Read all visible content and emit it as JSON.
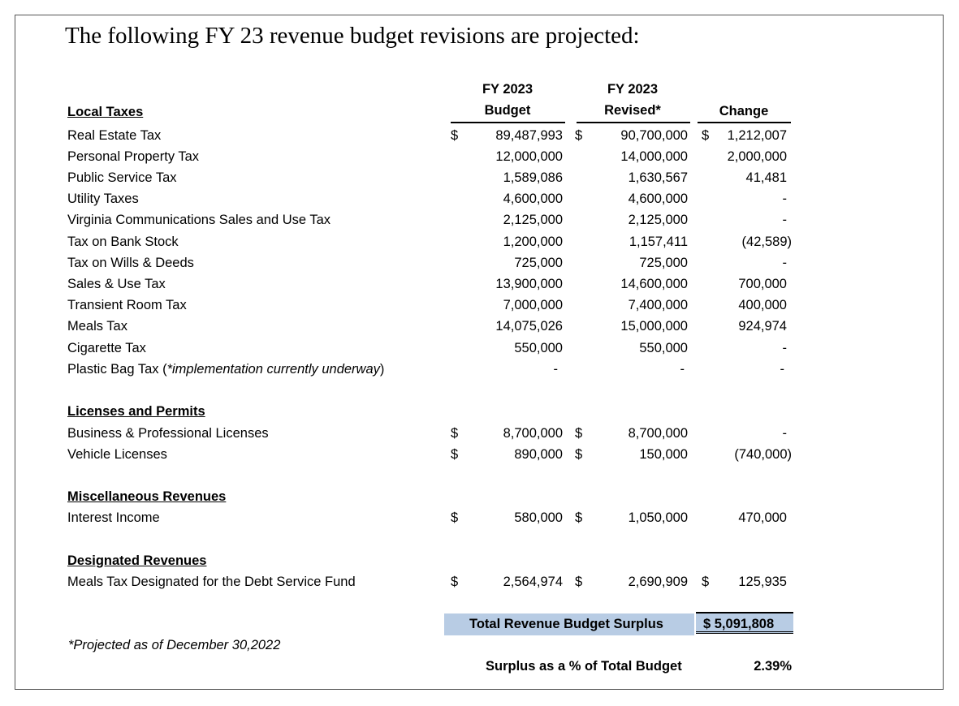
{
  "title": "The following FY 23 revenue budget revisions are projected:",
  "headers": {
    "budget_line1": "FY 2023",
    "budget_line2": "Budget",
    "revised_line1": "FY 2023",
    "revised_line2": "Revised*",
    "change": "Change"
  },
  "currency": "$",
  "sections": {
    "local_taxes": "Local Taxes",
    "licenses": "Licenses and Permits",
    "misc": "Miscellaneous Revenues",
    "designated": "Designated Revenues"
  },
  "rows": {
    "real_estate": {
      "label": "Real Estate Tax",
      "budget": "89,487,993",
      "revised": "90,700,000",
      "change": "1,212,007"
    },
    "personal_property": {
      "label": "Personal Property Tax",
      "budget": "12,000,000",
      "revised": "14,000,000",
      "change": "2,000,000"
    },
    "public_service": {
      "label": "Public Service Tax",
      "budget": "1,589,086",
      "revised": "1,630,567",
      "change": "41,481"
    },
    "utility": {
      "label": "Utility Taxes",
      "budget": "4,600,000",
      "revised": "4,600,000",
      "change": "-"
    },
    "vcsut": {
      "label": "Virginia Communications Sales and Use Tax",
      "budget": "2,125,000",
      "revised": "2,125,000",
      "change": "-"
    },
    "bank_stock": {
      "label": "Tax on Bank Stock",
      "budget": "1,200,000",
      "revised": "1,157,411",
      "change": "(42,589)"
    },
    "wills_deeds": {
      "label": "Tax on Wills & Deeds",
      "budget": "725,000",
      "revised": "725,000",
      "change": "-"
    },
    "sales_use": {
      "label": "Sales & Use Tax",
      "budget": "13,900,000",
      "revised": "14,600,000",
      "change": "700,000"
    },
    "transient": {
      "label": "Transient Room Tax",
      "budget": "7,000,000",
      "revised": "7,400,000",
      "change": "400,000"
    },
    "meals": {
      "label": "Meals Tax",
      "budget": "14,075,026",
      "revised": "15,000,000",
      "change": "924,974"
    },
    "cigarette": {
      "label": "Cigarette Tax",
      "budget": "550,000",
      "revised": "550,000",
      "change": "-"
    },
    "plastic_bag": {
      "label": "Plastic Bag Tax (",
      "note": "*implementation currently underway",
      "label_end": ")",
      "budget": "-",
      "revised": "-",
      "change": "-"
    },
    "business_licenses": {
      "label": "Business & Professional Licenses",
      "budget": "8,700,000",
      "revised": "8,700,000",
      "change": "-"
    },
    "vehicle_licenses": {
      "label": "Vehicle Licenses",
      "budget": "890,000",
      "revised": "150,000",
      "change": "(740,000)"
    },
    "interest": {
      "label": "Interest Income",
      "budget": "580,000",
      "revised": "1,050,000",
      "change": "470,000"
    },
    "meals_designated": {
      "label": "Meals Tax Designated for the Debt Service Fund",
      "budget": "2,564,974",
      "revised": "2,690,909",
      "change": "125,935"
    }
  },
  "total": {
    "label": "Total Revenue Budget Surplus",
    "value": "$ 5,091,808"
  },
  "percent": {
    "label": "Surplus as a % of Total Budget",
    "value": "2.39%"
  },
  "footnote": "*Projected as of December 30,2022"
}
